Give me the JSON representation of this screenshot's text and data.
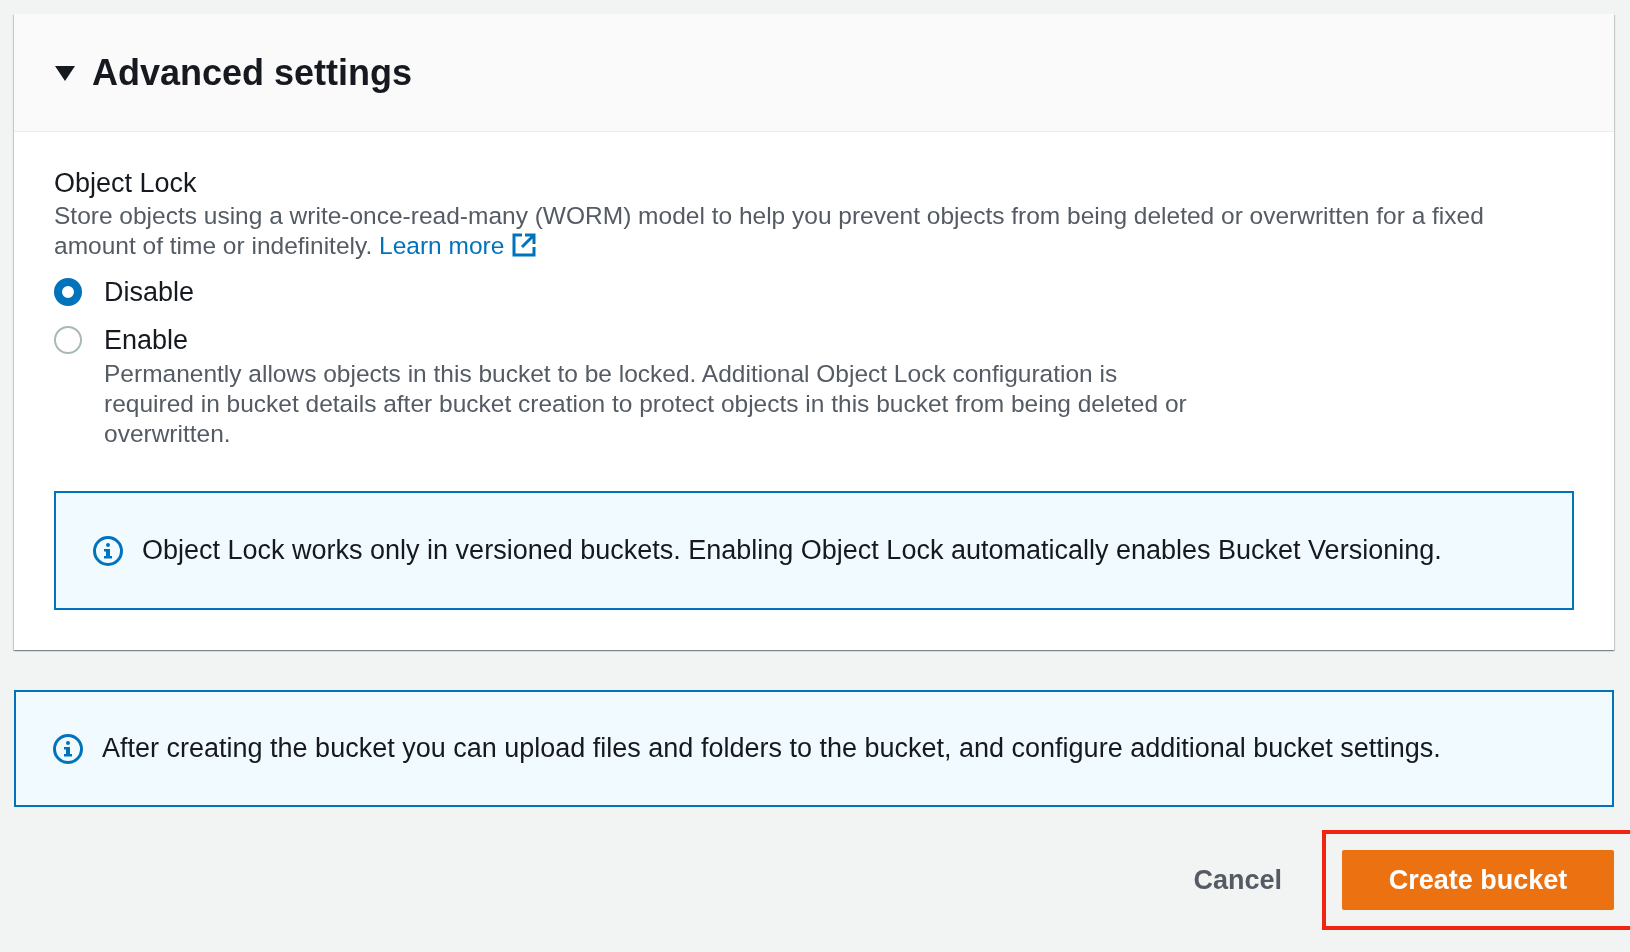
{
  "section": {
    "title": "Advanced settings",
    "expanded": true,
    "object_lock": {
      "label": "Object Lock",
      "description": "Store objects using a write-once-read-many (WORM) model to help you prevent objects from being deleted or overwritten for a fixed amount of time or indefinitely.",
      "link": "Learn more"
    },
    "options": [
      {
        "label": "Disable",
        "selected": true
      },
      {
        "label": "Enable",
        "selected": false,
        "description": "Permanently allows objects in this bucket to be locked. Additional Object Lock configuration is required in bucket details after bucket creation to protect objects in this bucket from being deleted or overwritten."
      }
    ],
    "info": "Object Lock works only in versioned buckets. Enabling Object Lock automatically enables Bucket Versioning."
  },
  "info": "After creating the bucket you can upload files and folders to the bucket, and configure additional bucket settings.",
  "buttons": [
    {
      "label": "Cancel",
      "kind": "link"
    },
    {
      "label": "Create bucket",
      "kind": "primary",
      "highlighted": true
    }
  ]
}
